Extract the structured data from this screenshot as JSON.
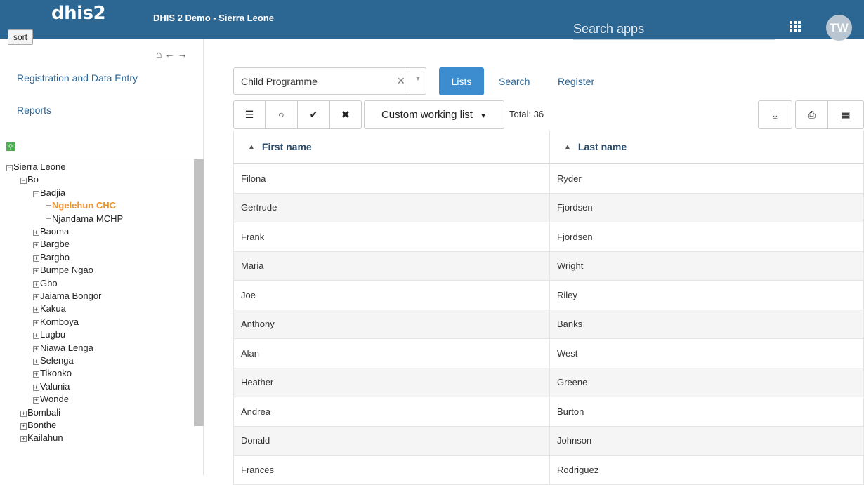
{
  "header": {
    "logo": "dhis2",
    "instance_name": "DHIS 2 Demo - Sierra Leone",
    "search_placeholder": "Search apps",
    "avatar_initials": "TW",
    "background_color": "#2c6693"
  },
  "tooltip": {
    "text": "sort"
  },
  "sidebar": {
    "nav_icons": [
      "home-icon",
      "back-arrow-icon",
      "forward-arrow-icon"
    ],
    "links": [
      "Registration and Data Entry",
      "Reports"
    ],
    "tree": [
      {
        "label": "Sierra Leone",
        "state": "expanded",
        "level": 0
      },
      {
        "label": "Bo",
        "state": "expanded",
        "level": 1
      },
      {
        "label": "Badjia",
        "state": "expanded",
        "level": 2
      },
      {
        "label": "Ngelehun CHC",
        "state": "leaf",
        "level": 3,
        "selected": true
      },
      {
        "label": "Njandama MCHP",
        "state": "leaf",
        "level": 3
      },
      {
        "label": "Baoma",
        "state": "collapsed",
        "level": 2
      },
      {
        "label": "Bargbe",
        "state": "collapsed",
        "level": 2
      },
      {
        "label": "Bargbo",
        "state": "collapsed",
        "level": 2
      },
      {
        "label": "Bumpe Ngao",
        "state": "collapsed",
        "level": 2
      },
      {
        "label": "Gbo",
        "state": "collapsed",
        "level": 2
      },
      {
        "label": "Jaiama Bongor",
        "state": "collapsed",
        "level": 2
      },
      {
        "label": "Kakua",
        "state": "collapsed",
        "level": 2
      },
      {
        "label": "Komboya",
        "state": "collapsed",
        "level": 2
      },
      {
        "label": "Lugbu",
        "state": "collapsed",
        "level": 2
      },
      {
        "label": "Niawa Lenga",
        "state": "collapsed",
        "level": 2
      },
      {
        "label": "Selenga",
        "state": "collapsed",
        "level": 2
      },
      {
        "label": "Tikonko",
        "state": "collapsed",
        "level": 2
      },
      {
        "label": "Valunia",
        "state": "collapsed",
        "level": 2
      },
      {
        "label": "Wonde",
        "state": "collapsed",
        "level": 2
      },
      {
        "label": "Bombali",
        "state": "collapsed",
        "level": 1
      },
      {
        "label": "Bonthe",
        "state": "collapsed",
        "level": 1
      },
      {
        "label": "Kailahun",
        "state": "collapsed",
        "level": 1
      }
    ],
    "selected_color": "#f0932b"
  },
  "main": {
    "program_select": {
      "value": "Child Programme"
    },
    "buttons": {
      "lists": "Lists",
      "search": "Search",
      "register": "Register"
    },
    "working_list": "Custom working list",
    "total": "Total: 36",
    "accent_color": "#3c8dd0",
    "table": {
      "columns": [
        "First name",
        "Last name"
      ],
      "rows": [
        [
          "Filona",
          "Ryder"
        ],
        [
          "Gertrude",
          "Fjordsen"
        ],
        [
          "Frank",
          "Fjordsen"
        ],
        [
          "Maria",
          "Wright"
        ],
        [
          "Joe",
          "Riley"
        ],
        [
          "Anthony",
          "Banks"
        ],
        [
          "Alan",
          "West"
        ],
        [
          "Heather",
          "Greene"
        ],
        [
          "Andrea",
          "Burton"
        ],
        [
          "Donald",
          "Johnson"
        ],
        [
          "Frances",
          "Rodriguez"
        ]
      ]
    }
  }
}
